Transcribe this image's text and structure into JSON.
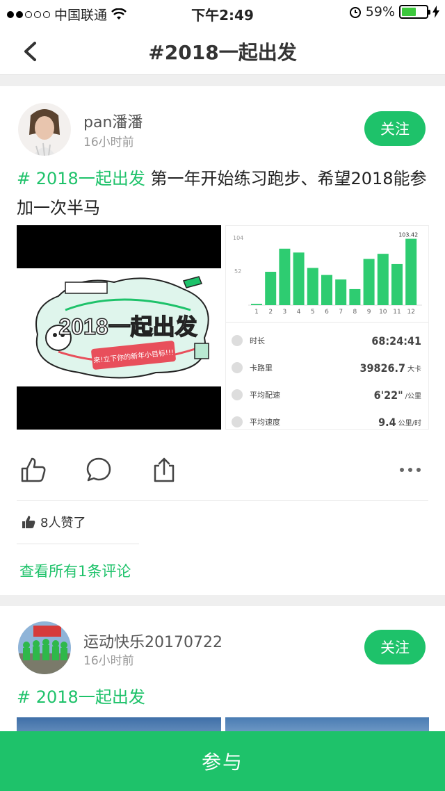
{
  "status_bar": {
    "carrier": "中国联通",
    "time": "下午2:49",
    "battery_percent": "59%",
    "battery_level": 0.59
  },
  "nav": {
    "title": "#2018一起出发"
  },
  "posts": [
    {
      "username": "pan潘潘",
      "time_ago": "16小时前",
      "follow_label": "关注",
      "hashtag": "# 2018一起出发",
      "text": " 第一年开始练习跑步、希望2018能参加一次半马",
      "image_text": {
        "title": "2018一起出发",
        "sub": "来!立下你的新年小目标!!!"
      },
      "run_chart": {
        "categories": [
          "1",
          "2",
          "3",
          "4",
          "5",
          "6",
          "7",
          "8",
          "9",
          "10",
          "11",
          "12"
        ],
        "values": [
          2,
          52,
          88,
          82,
          58,
          47,
          40,
          25,
          72,
          80,
          64,
          103.42
        ],
        "y_ticks": [
          "104",
          "52"
        ],
        "max_label": "103.42",
        "ylim": [
          0,
          104
        ]
      },
      "stats": [
        {
          "label": "时长",
          "value": "68:24:41",
          "unit": ""
        },
        {
          "label": "卡路里",
          "value": "39826.7",
          "unit": "大卡"
        },
        {
          "label": "平均配速",
          "value": "6'22\"",
          "unit": "/公里"
        },
        {
          "label": "平均速度",
          "value": "9.4",
          "unit": "公里/时"
        }
      ],
      "likes": "8人赞了",
      "comments_link": "查看所有1条评论"
    },
    {
      "username": "运动快乐20170722",
      "time_ago": "16小时前",
      "follow_label": "关注",
      "hashtag": "# 2018一起出发"
    }
  ],
  "join_button": "参与",
  "colors": {
    "accent": "#1ec26a",
    "bar": "#2ecc71"
  }
}
